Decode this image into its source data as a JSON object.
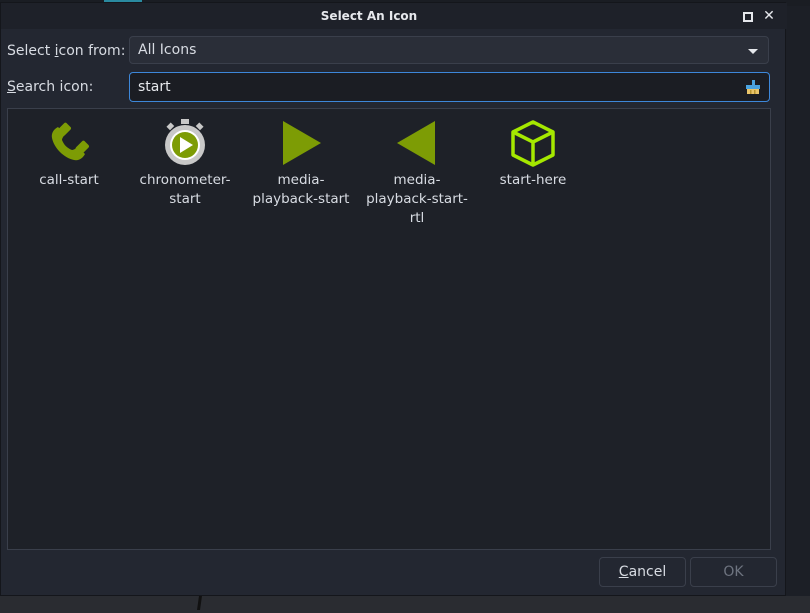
{
  "dialog": {
    "title": "Select An Icon",
    "maximize_icon": "maximize-icon",
    "close_symbol": "✕"
  },
  "source": {
    "label_pre": "Select ",
    "label_mnemonic": "i",
    "label_post": "con from:",
    "selected": "All Icons"
  },
  "search": {
    "label_pre": "",
    "label_mnemonic": "S",
    "label_post": "earch icon:",
    "value": "start",
    "clear_icon": "edit-clear-icon"
  },
  "icons": [
    {
      "name": "call-start",
      "label_lines": [
        "call-start"
      ],
      "icon": "phone-icon",
      "color": "#7d9c05"
    },
    {
      "name": "chronometer-start",
      "label_lines": [
        "chronometer-",
        "start"
      ],
      "icon": "stopwatch-play-icon",
      "color": "#7d9c05"
    },
    {
      "name": "media-playback-start",
      "label_lines": [
        "media-",
        "playback-start"
      ],
      "icon": "play-icon",
      "color": "#7d9c05"
    },
    {
      "name": "media-playback-start-rtl",
      "label_lines": [
        "media-",
        "playback-start-",
        "rtl"
      ],
      "icon": "play-rtl-icon",
      "color": "#7d9c05"
    },
    {
      "name": "start-here",
      "label_lines": [
        "start-here"
      ],
      "icon": "cube-icon",
      "color": "#a5e800"
    }
  ],
  "buttons": {
    "cancel_mnemonic": "C",
    "cancel_rest": "ancel",
    "ok": "OK"
  }
}
